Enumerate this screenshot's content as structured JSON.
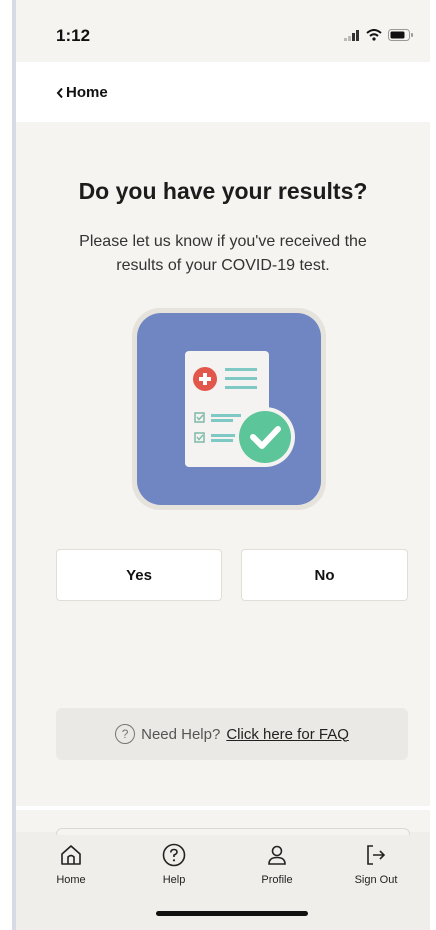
{
  "status_bar": {
    "time": "1:12",
    "icons": [
      "signal-icon",
      "wifi-icon",
      "battery-icon"
    ]
  },
  "nav": {
    "back_label": "Home",
    "back_icon": "chevron-left-icon"
  },
  "main": {
    "title": "Do you have your results?",
    "subtitle": "Please let us know if you've received the results of your COVID-19 test.",
    "illustration_icon": "test-results-document-icon"
  },
  "buttons": {
    "yes_label": "Yes",
    "no_label": "No"
  },
  "help": {
    "prefix": "Need Help?",
    "link_label": "Click here for FAQ",
    "icon": "question-circle-icon"
  },
  "tab_bar": {
    "items": [
      {
        "label": "Home",
        "icon": "home-icon"
      },
      {
        "label": "Help",
        "icon": "help-icon"
      },
      {
        "label": "Profile",
        "icon": "profile-icon"
      },
      {
        "label": "Sign Out",
        "icon": "sign-out-icon"
      }
    ]
  },
  "colors": {
    "background": "#f6f4f1",
    "illustration_bg": "#6f86c2",
    "check_green": "#5cc59a",
    "plus_red": "#e2574c"
  }
}
